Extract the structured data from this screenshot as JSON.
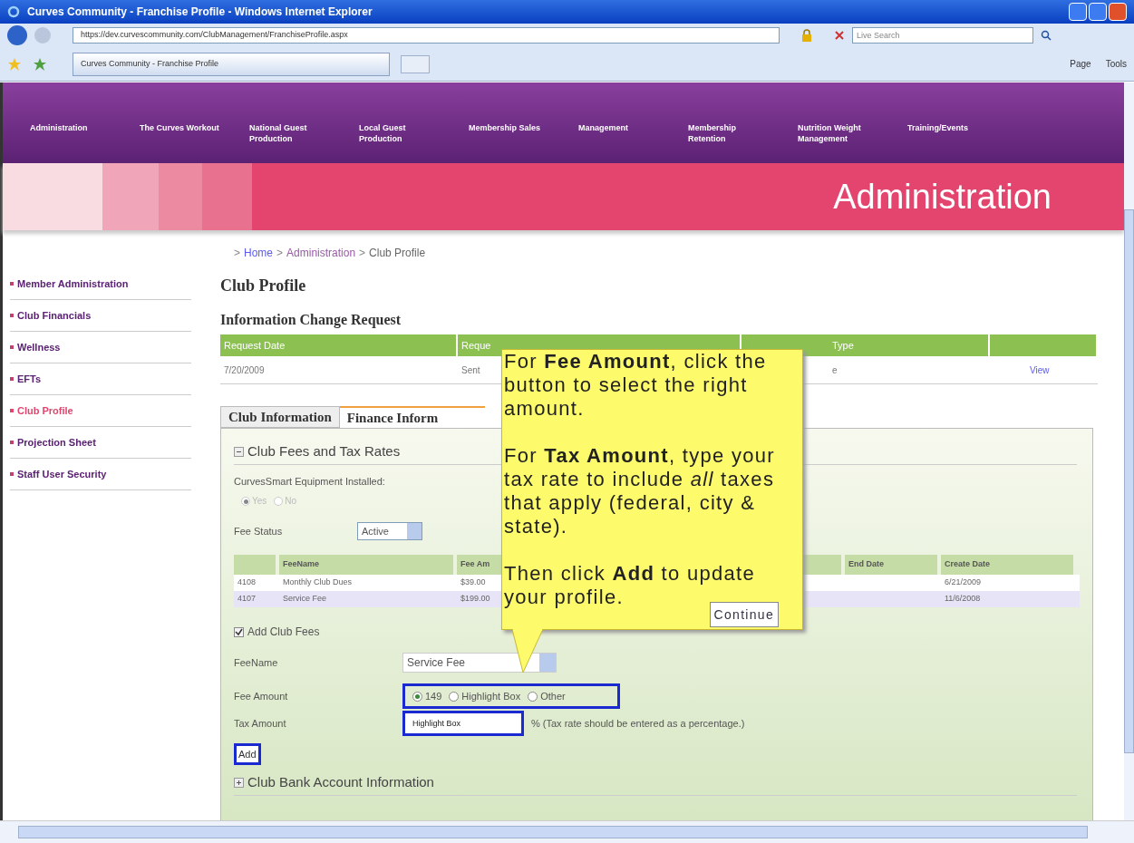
{
  "browser": {
    "title": "Curves Community - Franchise Profile - Windows Internet Explorer",
    "address": "https://dev.curvescommunity.com/ClubManagement/FranchiseProfile.aspx",
    "search_placeholder": "Live Search",
    "tab": "Curves Community - Franchise Profile",
    "tools": [
      "Page",
      "Tools"
    ]
  },
  "nav": [
    "Administration",
    "The Curves Workout",
    "National Guest Production",
    "Local Guest Production",
    "Membership Sales",
    "Management",
    "Membership Retention",
    "Nutrition Weight Management",
    "Training/Events"
  ],
  "banner": "Administration",
  "breadcrumb": {
    "separator": ">",
    "items": [
      "Home",
      "Administration",
      "Club Profile"
    ]
  },
  "sidebar": [
    {
      "label": "Member Administration",
      "selected": false
    },
    {
      "label": "Club Financials",
      "selected": false
    },
    {
      "label": "Wellness",
      "selected": false
    },
    {
      "label": "EFTs",
      "selected": false
    },
    {
      "label": "Club Profile",
      "selected": true
    },
    {
      "label": "Projection Sheet",
      "selected": false
    },
    {
      "label": "Staff User Security",
      "selected": false
    }
  ],
  "page_title": "Club Profile",
  "requests": {
    "title": "Information Change Request",
    "columns": [
      "Request Date",
      "Reque",
      "Type"
    ],
    "rows": [
      [
        "7/20/2009",
        "Sent",
        "e",
        "View"
      ]
    ]
  },
  "tabs": [
    {
      "label": "Club Information",
      "selected": false
    },
    {
      "label": "Finance Inform",
      "selected": true
    }
  ],
  "fees_section": {
    "title": "Club Fees and Tax Rates",
    "expanded": true
  },
  "equipment": {
    "label": "CurvesSmart Equipment Installed:",
    "options": [
      {
        "label": "Yes",
        "selected": true
      },
      {
        "label": "No",
        "selected": false
      }
    ]
  },
  "fee_status": {
    "label": "Fee Status",
    "value": "Active"
  },
  "fee_table": {
    "columns": [
      "FeeName",
      "Fee Am",
      "End Date",
      "Create Date"
    ],
    "rows": [
      {
        "id": "4108",
        "name": "Monthly Club Dues",
        "amount": "$39.00",
        "create": "6/21/2009"
      },
      {
        "id": "4107",
        "name": "Service Fee",
        "amount": "$199.00",
        "create": "11/6/2008"
      }
    ]
  },
  "add_fees": {
    "label": "Add Club Fees",
    "checked": true
  },
  "fee_name": {
    "label": "FeeName",
    "value": "Service Fee"
  },
  "fee_amount": {
    "label": "Fee Amount",
    "options": [
      {
        "label": "149",
        "selected": true
      },
      {
        "label": "Highlight Box",
        "selected": false
      },
      {
        "label": "Other",
        "selected": false
      }
    ]
  },
  "tax_amount": {
    "label": "Tax Amount",
    "value": "Highlight Box",
    "hint": "% (Tax rate should be entered as a percentage.)"
  },
  "add_button": "Add",
  "bank_section": {
    "title": "Club Bank Account Information",
    "expanded": false
  },
  "tooltip": {
    "paragraphs": [
      "For **Fee Amount**, click the button to select the right amount.",
      "For **Tax Amount**, type your tax rate to include *all* taxes that apply (federal, city & state).",
      "Then click **Add** to update your profile."
    ],
    "button": "Continue"
  }
}
